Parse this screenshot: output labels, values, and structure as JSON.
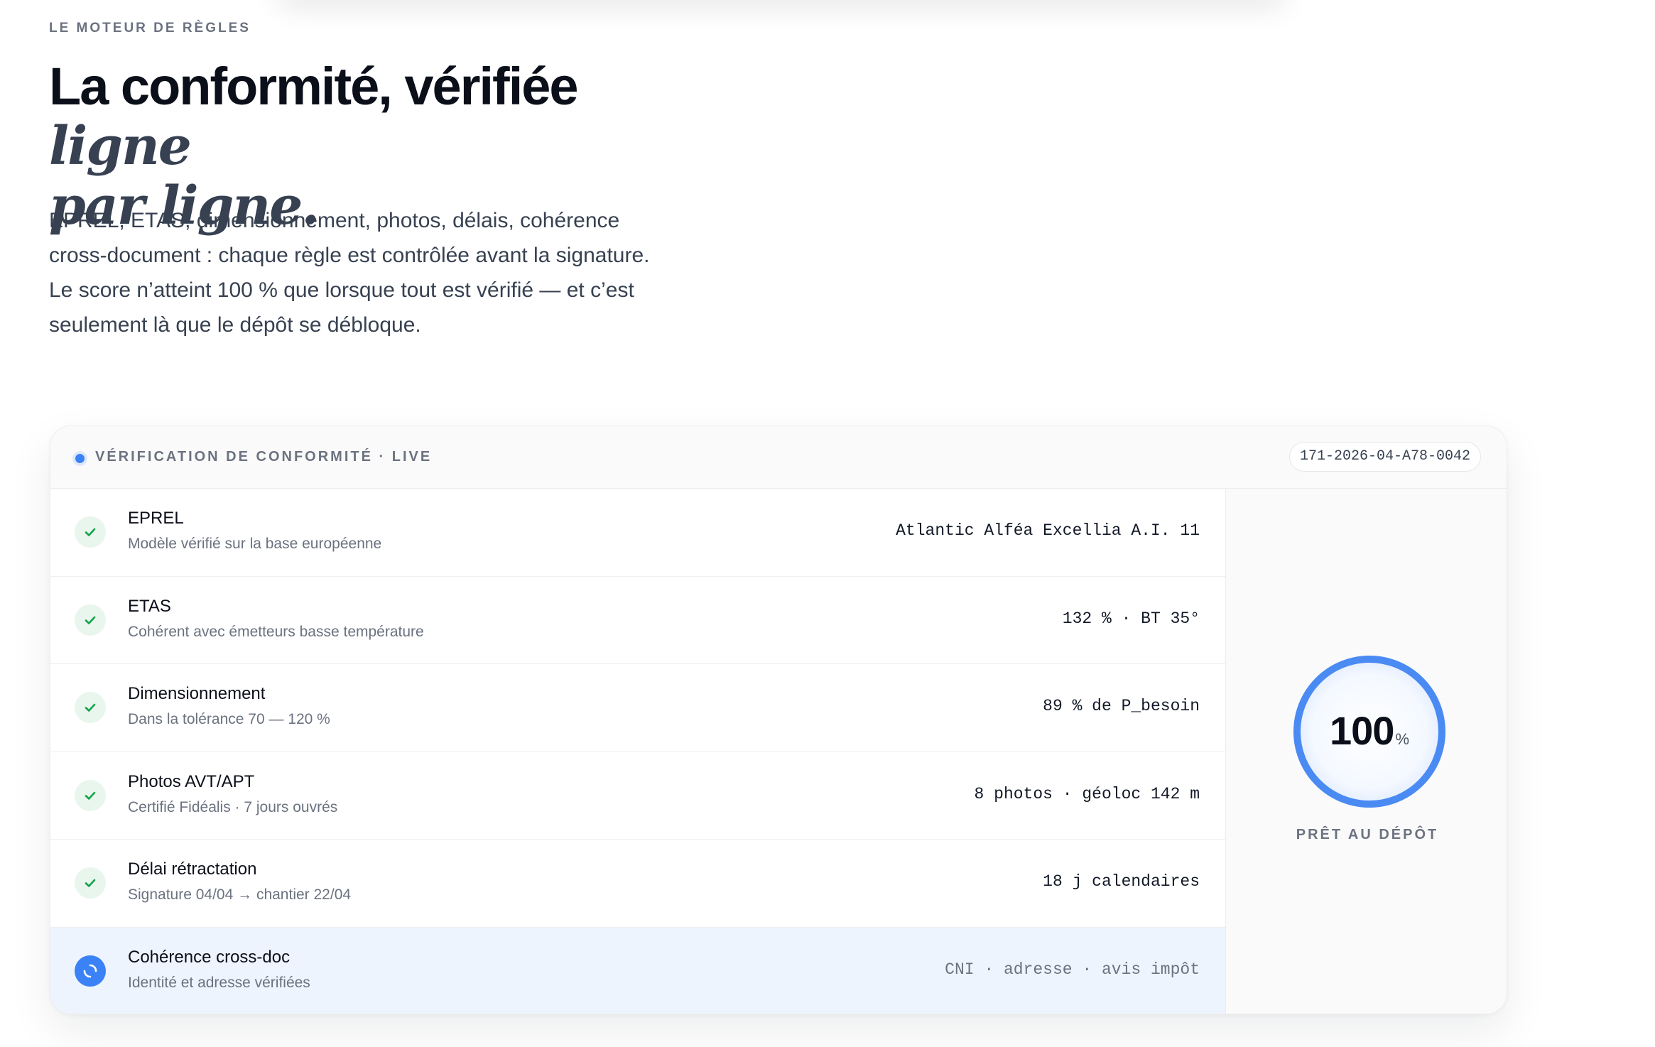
{
  "hero": {
    "eyebrow": "LE MOTEUR DE RÈGLES",
    "title_plain": "La conformité, vérifiée ",
    "title_italic_1": "ligne",
    "title_italic_2": "par ligne.",
    "lead": "EPREL, ETAS, dimensionnement, photos, délais, cohérence cross-document : chaque règle est contrôlée avant la signature. Le score n’atteint 100 % que lorsque tout est vérifié — et c’est seulement là que le dépôt se débloque."
  },
  "panel": {
    "title": "VÉRIFICATION DE CONFORMITÉ · LIVE",
    "reference": "171-2026-04-A78-0042",
    "rows": [
      {
        "title": "EPREL",
        "subtitle": "Modèle vérifié sur la base européenne",
        "value": "Atlantic Alféa Excellia A.I. 11",
        "status": "verified"
      },
      {
        "title": "ETAS",
        "subtitle": "Cohérent avec émetteurs basse température",
        "value": "132 % · BT 35°",
        "status": "verified"
      },
      {
        "title": "Dimensionnement",
        "subtitle": "Dans la tolérance 70 — 120 %",
        "value": "89 % de P_besoin",
        "status": "verified"
      },
      {
        "title": "Photos AVT/APT",
        "subtitle": "Certifié Fidéalis · 7 jours ouvrés",
        "value": "8 photos · géoloc 142 m",
        "status": "verified"
      },
      {
        "title": "Délai rétractation",
        "subtitle": "Signature 04/04 → chantier 22/04",
        "value": "18 j calendaires",
        "status": "verified"
      },
      {
        "title": "Cohérence cross-doc",
        "subtitle": "Identité et adresse vérifiées",
        "value": "CNI · adresse · avis impôt",
        "status": "in-progress"
      }
    ],
    "score": {
      "value": "100",
      "unit": "%",
      "progress": 1.0,
      "label": "PRÊT AU DÉPÔT"
    }
  },
  "colors": {
    "accent": "#3b82f6",
    "success": "#16a34a",
    "success_bg": "#e9f6ee",
    "active_row_bg": "#eef4fd"
  },
  "icons": {
    "verified": "check-icon",
    "in-progress": "spinner-icon",
    "live": "live-dot-icon"
  }
}
